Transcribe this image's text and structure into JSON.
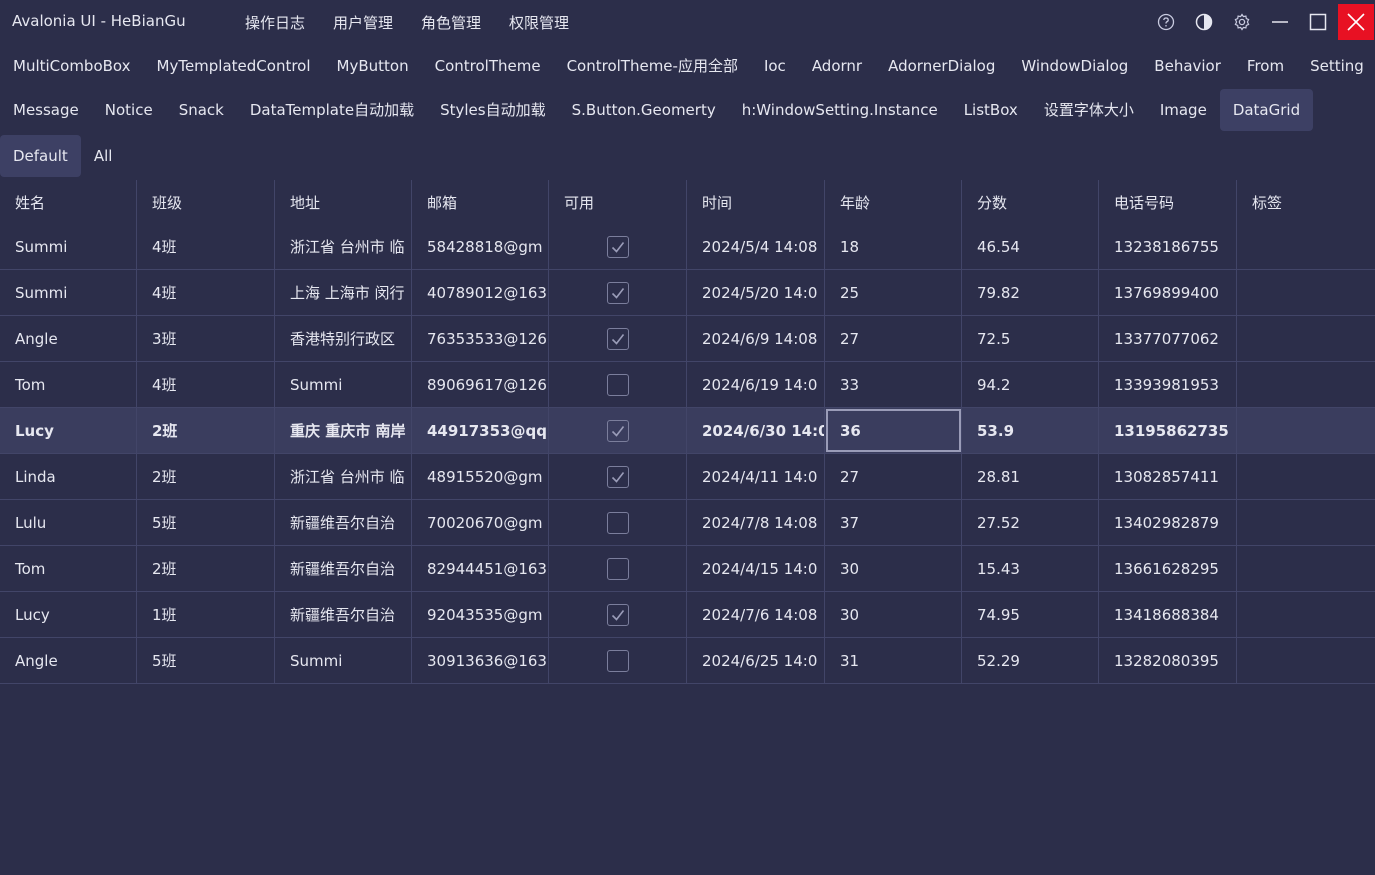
{
  "app": {
    "title": "Avalonia UI - HeBianGu"
  },
  "top_menu": [
    "操作日志",
    "用户管理",
    "角色管理",
    "权限管理"
  ],
  "window_controls": [
    "help-icon",
    "theme-icon",
    "settings-icon",
    "minimize-icon",
    "maximize-icon",
    "close-icon"
  ],
  "tabs_row1": [
    "MultiComboBox",
    "MyTemplatedControl",
    "MyButton",
    "ControlTheme",
    "ControlTheme-应用全部",
    "Ioc",
    "Adornr",
    "AdornerDialog",
    "WindowDialog",
    "Behavior",
    "From",
    "Setting"
  ],
  "tabs_row2": [
    "Message",
    "Notice",
    "Snack",
    "DataTemplate自动加载",
    "Styles自动加载",
    "S.Button.Geomerty",
    "h:WindowSetting.Instance",
    "ListBox",
    "设置字体大小",
    "Image",
    "DataGrid"
  ],
  "selected_tab": "DataGrid",
  "subtabs": [
    "Default",
    "All"
  ],
  "selected_subtab": "Default",
  "columns": [
    "姓名",
    "班级",
    "地址",
    "邮箱",
    "可用",
    "时间",
    "年龄",
    "分数",
    "电话号码",
    "标签"
  ],
  "rows": [
    {
      "name": "Summi",
      "class": "4班",
      "address": "浙江省 台州市 临",
      "email": "58428818@gm",
      "enabled": true,
      "time": "2024/5/4 14:08",
      "age": "18",
      "score": "46.54",
      "phone": "13238186755",
      "tag": ""
    },
    {
      "name": "Summi",
      "class": "4班",
      "address": "上海 上海市 闵行",
      "email": "40789012@163",
      "enabled": true,
      "time": "2024/5/20 14:0",
      "age": "25",
      "score": "79.82",
      "phone": "13769899400",
      "tag": ""
    },
    {
      "name": "Angle",
      "class": "3班",
      "address": "香港特别行政区",
      "email": "76353533@126",
      "enabled": true,
      "time": "2024/6/9 14:08",
      "age": "27",
      "score": "72.5",
      "phone": "13377077062",
      "tag": ""
    },
    {
      "name": "Tom",
      "class": "4班",
      "address": "Summi",
      "email": "89069617@126",
      "enabled": false,
      "time": "2024/6/19 14:0",
      "age": "33",
      "score": "94.2",
      "phone": "13393981953",
      "tag": ""
    },
    {
      "name": "Lucy",
      "class": "2班",
      "address": "重庆 重庆市 南岸",
      "email": "44917353@qq",
      "enabled": true,
      "time": "2024/6/30 14:0",
      "age": "36",
      "score": "53.9",
      "phone": "13195862735",
      "tag": ""
    },
    {
      "name": "Linda",
      "class": "2班",
      "address": "浙江省 台州市 临",
      "email": "48915520@gm",
      "enabled": true,
      "time": "2024/4/11 14:0",
      "age": "27",
      "score": "28.81",
      "phone": "13082857411",
      "tag": ""
    },
    {
      "name": "Lulu",
      "class": "5班",
      "address": "新疆维吾尔自治",
      "email": "70020670@gm",
      "enabled": false,
      "time": "2024/7/8 14:08",
      "age": "37",
      "score": "27.52",
      "phone": "13402982879",
      "tag": ""
    },
    {
      "name": "Tom",
      "class": "2班",
      "address": "新疆维吾尔自治",
      "email": "82944451@163",
      "enabled": false,
      "time": "2024/4/15 14:0",
      "age": "30",
      "score": "15.43",
      "phone": "13661628295",
      "tag": ""
    },
    {
      "name": "Lucy",
      "class": "1班",
      "address": "新疆维吾尔自治",
      "email": "92043535@gm",
      "enabled": true,
      "time": "2024/7/6 14:08",
      "age": "30",
      "score": "74.95",
      "phone": "13418688384",
      "tag": ""
    },
    {
      "name": "Angle",
      "class": "5班",
      "address": "Summi",
      "email": "30913636@163",
      "enabled": false,
      "time": "2024/6/25 14:0",
      "age": "31",
      "score": "52.29",
      "phone": "13282080395",
      "tag": ""
    }
  ],
  "selected_row": 4,
  "focused_cell": "age"
}
